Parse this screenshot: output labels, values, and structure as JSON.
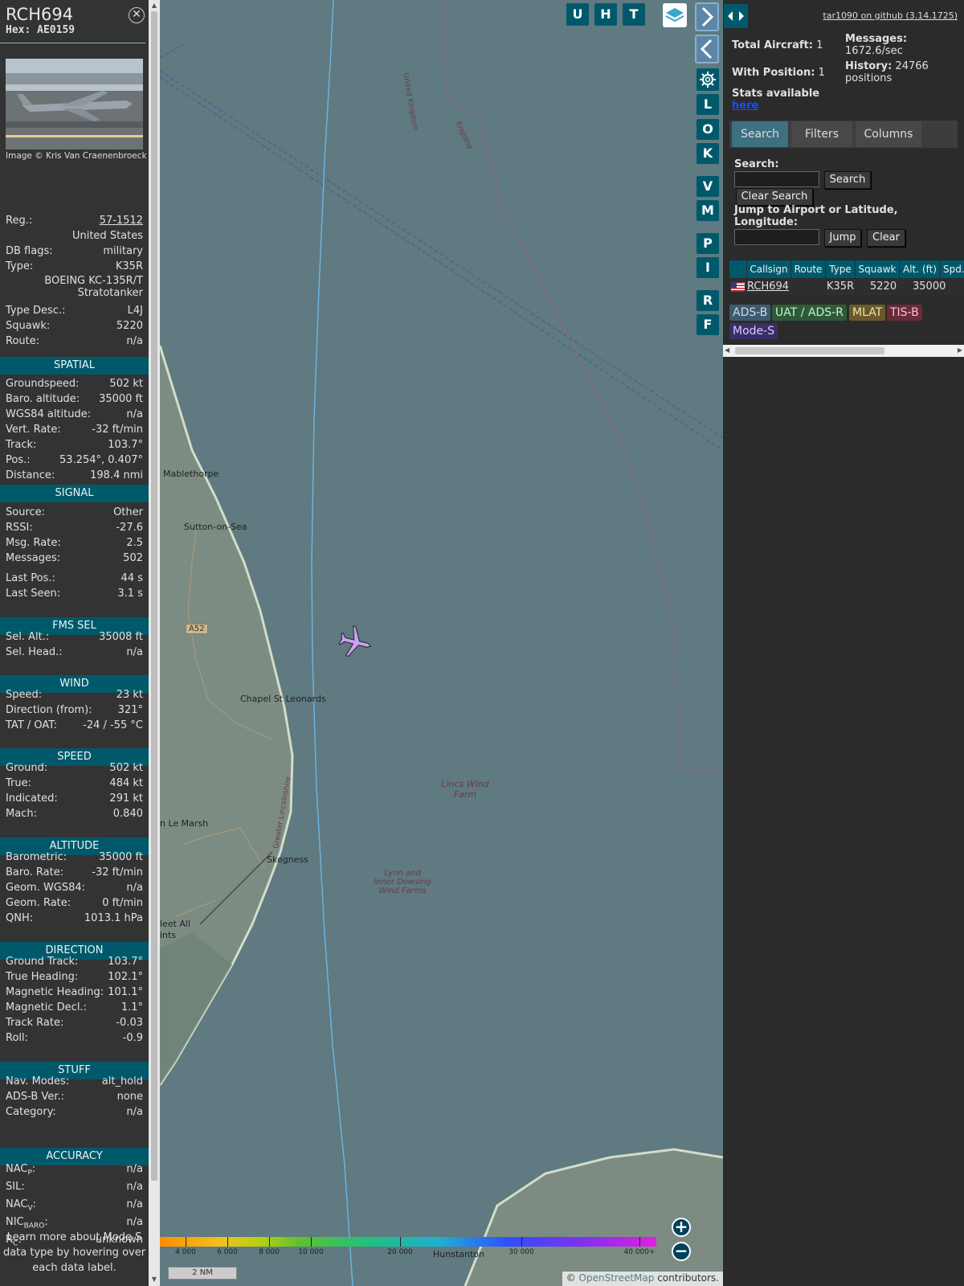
{
  "sidebar": {
    "callsign": "RCH694",
    "hex_label": "Hex:",
    "hex": "AE0159",
    "close_icon": "close-icon",
    "photo_credit": "Image © Kris Van Craenenbroeck",
    "rows_top": [
      {
        "k": "Reg.:",
        "v": "57-1512"
      },
      {
        "k": "",
        "v": "United States"
      },
      {
        "k": "DB flags:",
        "v": "military"
      },
      {
        "k": "Type:",
        "v": "K35R"
      },
      {
        "k": "",
        "v": "BOEING KC-135R/T"
      },
      {
        "k": "",
        "v": "Stratotanker"
      },
      {
        "k": "Type Desc.:",
        "v": "L4J"
      },
      {
        "k": "Squawk:",
        "v": "5220"
      },
      {
        "k": "Route:",
        "v": "n/a"
      }
    ],
    "sections": {
      "spatial": "SPATIAL",
      "signal": "SIGNAL",
      "fms": "FMS SEL",
      "wind": "WIND",
      "speed": "SPEED",
      "altitude": "ALTITUDE",
      "direction": "DIRECTION",
      "stuff": "STUFF",
      "accuracy": "ACCURACY"
    },
    "spatial": [
      {
        "k": "Groundspeed:",
        "v": "502 kt"
      },
      {
        "k": "Baro. altitude:",
        "v": "35000 ft"
      },
      {
        "k": "WGS84 altitude:",
        "v": "n/a"
      },
      {
        "k": "Vert. Rate:",
        "v": "-32 ft/min"
      },
      {
        "k": "Track:",
        "v": "103.7°"
      },
      {
        "k": "Pos.:",
        "v": "53.254°, 0.407°"
      },
      {
        "k": "Distance:",
        "v": "198.4 nmi"
      }
    ],
    "signal": [
      {
        "k": "Source:",
        "v": "Other"
      },
      {
        "k": "RSSI:",
        "v": "-27.6"
      },
      {
        "k": "Msg. Rate:",
        "v": "2.5"
      },
      {
        "k": "Messages:",
        "v": "502"
      },
      {
        "k": "Last Pos.:",
        "v": "44 s"
      },
      {
        "k": "Last Seen:",
        "v": "3.1 s"
      }
    ],
    "fms": [
      {
        "k": "Sel. Alt.:",
        "v": "35008 ft"
      },
      {
        "k": "Sel. Head.:",
        "v": "n/a"
      }
    ],
    "wind": [
      {
        "k": "Speed:",
        "v": "23 kt"
      },
      {
        "k": "Direction (from):",
        "v": "321°"
      },
      {
        "k": "TAT / OAT:",
        "v": "-24 / -55 °C"
      }
    ],
    "speed": [
      {
        "k": "Ground:",
        "v": "502 kt"
      },
      {
        "k": "True:",
        "v": "484 kt"
      },
      {
        "k": "Indicated:",
        "v": "291 kt"
      },
      {
        "k": "Mach:",
        "v": "0.840"
      }
    ],
    "altitude": [
      {
        "k": "Barometric:",
        "v": "35000 ft"
      },
      {
        "k": "Baro. Rate:",
        "v": "-32 ft/min"
      },
      {
        "k": "Geom. WGS84:",
        "v": "n/a"
      },
      {
        "k": "Geom. Rate:",
        "v": "0 ft/min"
      },
      {
        "k": "QNH:",
        "v": "1013.1 hPa"
      }
    ],
    "direction": [
      {
        "k": "Ground Track:",
        "v": "103.7°"
      },
      {
        "k": "True Heading:",
        "v": "102.1°"
      },
      {
        "k": "Magnetic Heading:",
        "v": "101.1°"
      },
      {
        "k": "Magnetic Decl.:",
        "v": "1.1°"
      },
      {
        "k": "Track Rate:",
        "v": "-0.03"
      },
      {
        "k": "Roll:",
        "v": "-0.9"
      }
    ],
    "stuff": [
      {
        "k": "Nav. Modes:",
        "v": "alt_hold"
      },
      {
        "k": "ADS-B Ver.:",
        "v": "none"
      },
      {
        "k": "Category:",
        "v": "n/a"
      }
    ],
    "accuracy": [
      {
        "k": "NAC",
        "sub": "P",
        "v": "n/a"
      },
      {
        "k": "SIL:",
        "sub": "",
        "v": "n/a"
      },
      {
        "k": "NAC",
        "sub": "V",
        "v": "n/a"
      },
      {
        "k": "NIC",
        "sub": "BARO",
        "v": "n/a"
      },
      {
        "k": "R",
        "sub": "C",
        "v": "unknown"
      }
    ],
    "footer": "Learn more about Mode S data type by hovering over each data label."
  },
  "map": {
    "buttons": [
      "U",
      "H",
      "T"
    ],
    "side_buttons": [
      "L",
      "O",
      "K",
      "V",
      "M",
      "P",
      "I",
      "R",
      "F"
    ],
    "places": [
      "Mablethorpe",
      "Sutton-on-Sea",
      "Chapel St Leonards",
      "Skegness",
      "n Le Marsh",
      "leet All",
      "ints",
      "Hunstanton"
    ],
    "road_label": "A52",
    "wind_farm_1": [
      "Lincs Wind",
      "Farm"
    ],
    "wind_farm_2": [
      "Lynn and",
      "Inner Dowsing",
      "Wind Farms"
    ],
    "border_labels": [
      "United Kingdom",
      "England",
      "Greater Lincolnshire"
    ],
    "alt_scale": [
      "4 000",
      "6 000",
      "8 000",
      "10 000",
      "20 000",
      "30 000",
      "40 000+"
    ],
    "scale_bar": "2 NM",
    "attribution_prefix": "© ",
    "attribution_link": "OpenStreetMap",
    "attribution_suffix": " contributors."
  },
  "panel": {
    "github": "tar1090 on github (3.14.1725)",
    "total_aircraft_label": "Total Aircraft:",
    "total_aircraft": "1",
    "with_position_label": "With Position:",
    "with_position": "1",
    "messages_label": "Messages:",
    "messages": "1672.6/sec",
    "history_label": "History:",
    "history": "24766",
    "history_unit": "positions",
    "stats_label": "Stats available",
    "stats_link": "here",
    "tabs": [
      "Search",
      "Filters",
      "Columns"
    ],
    "search_label": "Search:",
    "search_button": "Search",
    "clear_search": "Clear Search",
    "jump_label": "Jump to Airport or Latitude, Longitude:",
    "jump_button": "Jump",
    "clear_button": "Clear",
    "columns": [
      "Callsign",
      "Route",
      "Type",
      "Squawk",
      "Alt. (ft)",
      "Spd."
    ],
    "aircraft": {
      "callsign": "RCH694",
      "type": "K35R",
      "squawk": "5220",
      "alt": "35000"
    },
    "badges": [
      "ADS-B",
      "UAT / ADS-R",
      "MLAT",
      "TIS-B",
      "Mode-S"
    ]
  },
  "colors": {
    "accent": "#00596b",
    "aircraft": "#c9a0f0",
    "map_sea": "#5f7a80",
    "map_land": "#7d8c83"
  }
}
